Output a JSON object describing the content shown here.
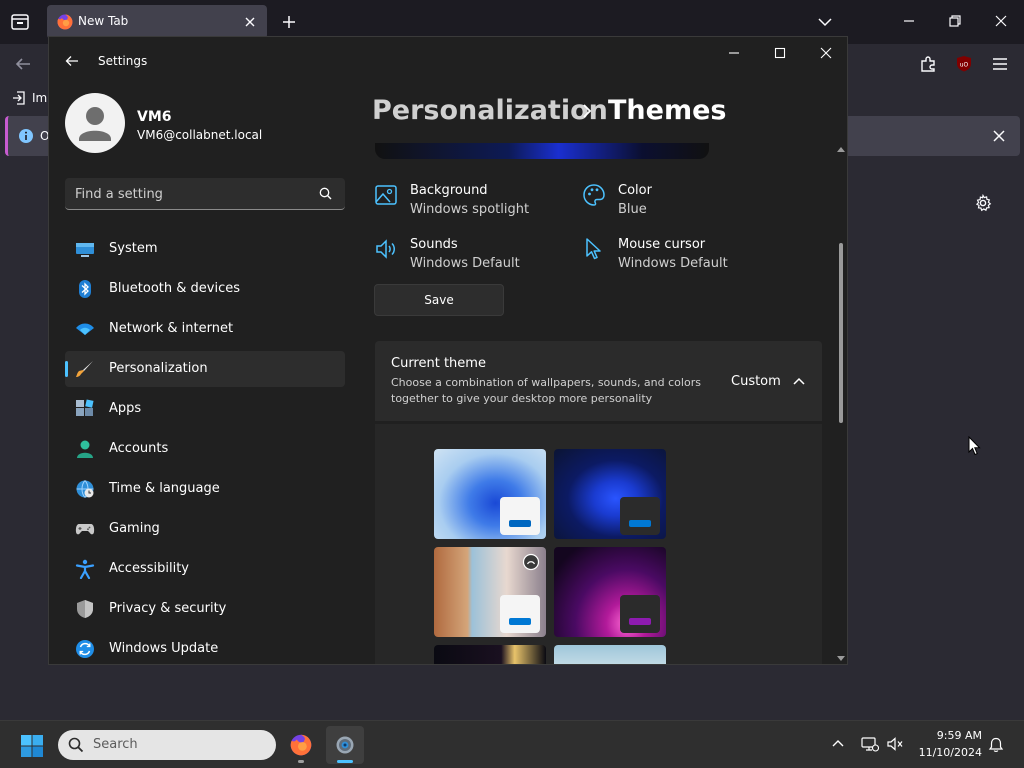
{
  "browser": {
    "tab_title": "New Tab",
    "bookmark_import_label": "Import bookmarks",
    "notice_text": "O"
  },
  "settings": {
    "window_title": "Settings",
    "user": {
      "name": "VM6",
      "email": "VM6@collabnet.local"
    },
    "search": {
      "placeholder": "Find a setting"
    },
    "nav": [
      {
        "label": "System",
        "icon": "system-icon",
        "selected": false
      },
      {
        "label": "Bluetooth & devices",
        "icon": "bluetooth-icon",
        "selected": false
      },
      {
        "label": "Network & internet",
        "icon": "wifi-icon",
        "selected": false
      },
      {
        "label": "Personalization",
        "icon": "paintbrush-icon",
        "selected": true
      },
      {
        "label": "Apps",
        "icon": "apps-icon",
        "selected": false
      },
      {
        "label": "Accounts",
        "icon": "accounts-icon",
        "selected": false
      },
      {
        "label": "Time & language",
        "icon": "globe-clock-icon",
        "selected": false
      },
      {
        "label": "Gaming",
        "icon": "gamepad-icon",
        "selected": false
      },
      {
        "label": "Accessibility",
        "icon": "accessibility-icon",
        "selected": false
      },
      {
        "label": "Privacy & security",
        "icon": "shield-icon",
        "selected": false
      },
      {
        "label": "Windows Update",
        "icon": "windows-update-icon",
        "selected": false
      }
    ],
    "breadcrumb": {
      "parent": "Personalization",
      "current": "Themes"
    },
    "properties": {
      "background": {
        "name": "Background",
        "value": "Windows spotlight",
        "icon": "background-image-icon"
      },
      "color": {
        "name": "Color",
        "value": "Blue",
        "icon": "palette-icon"
      },
      "sounds": {
        "name": "Sounds",
        "value": "Windows Default",
        "icon": "speaker-icon"
      },
      "cursor": {
        "name": "Mouse cursor",
        "value": "Windows Default",
        "icon": "cursor-arrow-icon"
      }
    },
    "save_label": "Save",
    "current_theme": {
      "title": "Current theme",
      "description": "Choose a combination of wallpapers, sounds, and colors together to give your desktop more personality",
      "value": "Custom"
    },
    "theme_thumbnails": [
      {
        "name": "windows-light",
        "accent": "#0067c0"
      },
      {
        "name": "windows-dark",
        "accent": "#0078d4"
      },
      {
        "name": "windows-spotlight",
        "accent": "#0078d4"
      },
      {
        "name": "glow",
        "accent": "#8e1bb0"
      },
      {
        "name": "captured-motion",
        "accent": ""
      },
      {
        "name": "flow",
        "accent": ""
      }
    ]
  },
  "taskbar": {
    "search_label": "Search",
    "time": "9:59 AM",
    "date": "11/10/2024"
  },
  "colors": {
    "accent": "#4cc2ff",
    "window_background": "#202020",
    "selected_item": "#2d2d2d"
  }
}
